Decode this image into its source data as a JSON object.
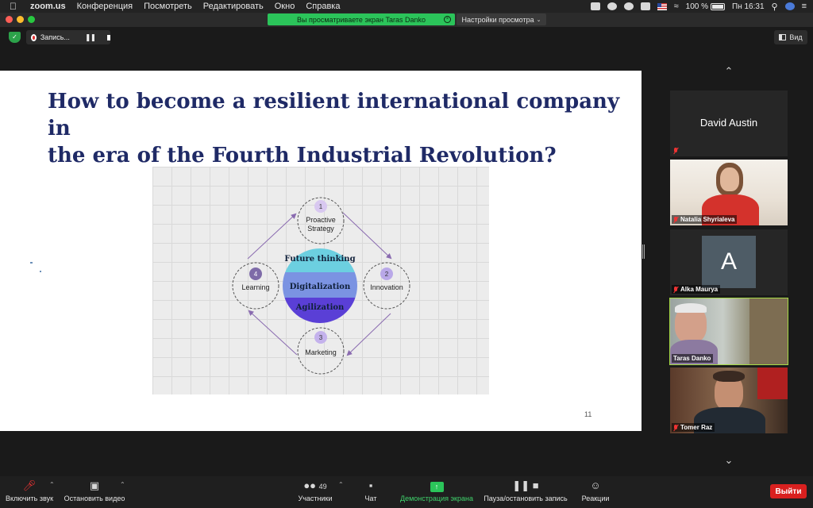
{
  "menubar": {
    "app_name": "zoom.us",
    "menus": [
      "Конференция",
      "Посмотреть",
      "Редактировать",
      "Окно",
      "Справка"
    ],
    "battery": "100 %",
    "clock": "Пн 16:31"
  },
  "titlebar": {
    "share_banner": "Вы просматриваете экран Taras Danko",
    "view_settings": "Настройки просмотра"
  },
  "topbar": {
    "recording_label": "Запись...",
    "view_label": "Вид"
  },
  "slide": {
    "title_line1": "How to become a resilient international company in",
    "title_line2": "the era of the Fourth Industrial Revolution?",
    "page_number": "11",
    "diagram": {
      "center": [
        "Future thinking",
        "Digitalization",
        "Agilization"
      ],
      "nodes": [
        {
          "num": "1",
          "label_line1": "Proactive",
          "label_line2": "Strategy"
        },
        {
          "num": "2",
          "label_line1": "Innovation",
          "label_line2": ""
        },
        {
          "num": "3",
          "label_line1": "Marketing",
          "label_line2": ""
        },
        {
          "num": "4",
          "label_line1": "Learning",
          "label_line2": ""
        }
      ]
    }
  },
  "participants": [
    {
      "name": "David Austin",
      "video": false
    },
    {
      "name": "Natalia Shyrialeva",
      "video": true
    },
    {
      "name": "Alka Maurya",
      "video": false,
      "avatar_letter": "A"
    },
    {
      "name": "Taras Danko",
      "video": true,
      "active_speaker": true
    },
    {
      "name": "Tomer Raz",
      "video": true
    }
  ],
  "toolbar": {
    "unmute": "Включить звук",
    "stop_video": "Остановить видео",
    "participants_count": "49",
    "participants": "Участники",
    "chat": "Чат",
    "share_screen": "Демонстрация экрана",
    "pause_record": "Пауза/остановить запись",
    "reactions": "Реакции",
    "leave": "Выйти"
  },
  "colors": {
    "title_navy": "#1f2a66",
    "share_green": "#2bc45a",
    "leave_red": "#d9201f",
    "active_outline": "#a6d945"
  }
}
